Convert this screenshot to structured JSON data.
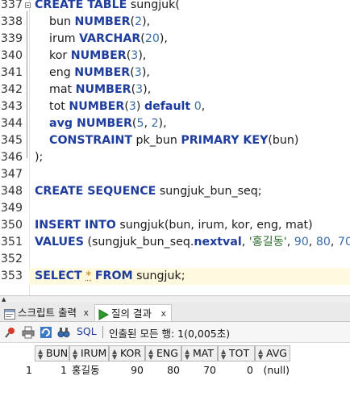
{
  "editor": {
    "lines": [
      {
        "num": "337",
        "code": [
          [
            "kw",
            "CREATE TABLE"
          ],
          [
            "t",
            " sungjuk("
          ]
        ]
      },
      {
        "num": "338",
        "code": [
          [
            "t",
            "    bun "
          ],
          [
            "kw",
            "NUMBER"
          ],
          [
            "t",
            "("
          ],
          [
            "num",
            "2"
          ],
          [
            "t",
            "),"
          ]
        ]
      },
      {
        "num": "339",
        "code": [
          [
            "t",
            "    irum "
          ],
          [
            "kw",
            "VARCHAR"
          ],
          [
            "t",
            "("
          ],
          [
            "num",
            "20"
          ],
          [
            "t",
            "),"
          ]
        ]
      },
      {
        "num": "340",
        "code": [
          [
            "t",
            "    kor "
          ],
          [
            "kw",
            "NUMBER"
          ],
          [
            "t",
            "("
          ],
          [
            "num",
            "3"
          ],
          [
            "t",
            "),"
          ]
        ]
      },
      {
        "num": "341",
        "code": [
          [
            "t",
            "    eng "
          ],
          [
            "kw",
            "NUMBER"
          ],
          [
            "t",
            "("
          ],
          [
            "num",
            "3"
          ],
          [
            "t",
            "),"
          ]
        ]
      },
      {
        "num": "342",
        "code": [
          [
            "t",
            "    mat "
          ],
          [
            "kw",
            "NUMBER"
          ],
          [
            "t",
            "("
          ],
          [
            "num",
            "3"
          ],
          [
            "t",
            "),"
          ]
        ]
      },
      {
        "num": "343",
        "code": [
          [
            "t",
            "    tot "
          ],
          [
            "kw",
            "NUMBER"
          ],
          [
            "t",
            "("
          ],
          [
            "num",
            "3"
          ],
          [
            "t",
            ") "
          ],
          [
            "kw",
            "default"
          ],
          [
            "t",
            " "
          ],
          [
            "num",
            "0"
          ],
          [
            "t",
            ","
          ]
        ]
      },
      {
        "num": "344",
        "code": [
          [
            "t",
            "    "
          ],
          [
            "kw",
            "avg NUMBER"
          ],
          [
            "t",
            "("
          ],
          [
            "num",
            "5"
          ],
          [
            "t",
            ", "
          ],
          [
            "num",
            "2"
          ],
          [
            "t",
            "),"
          ]
        ]
      },
      {
        "num": "345",
        "code": [
          [
            "t",
            "    "
          ],
          [
            "kw",
            "CONSTRAINT"
          ],
          [
            "t",
            " pk_bun "
          ],
          [
            "kw",
            "PRIMARY KEY"
          ],
          [
            "t",
            "(bun)"
          ]
        ]
      },
      {
        "num": "346",
        "code": [
          [
            "t",
            ");"
          ]
        ]
      },
      {
        "num": "347",
        "code": []
      },
      {
        "num": "348",
        "code": [
          [
            "kw",
            "CREATE SEQUENCE"
          ],
          [
            "t",
            " sungjuk_bun_seq;"
          ]
        ]
      },
      {
        "num": "349",
        "code": []
      },
      {
        "num": "350",
        "code": [
          [
            "kw",
            "INSERT INTO"
          ],
          [
            "t",
            " sungjuk(bun, irum, kor, eng, mat)"
          ]
        ]
      },
      {
        "num": "351",
        "code": [
          [
            "kw",
            "VALUES"
          ],
          [
            "t",
            " (sungjuk_bun_seq."
          ],
          [
            "kw",
            "nextval"
          ],
          [
            "t",
            ", "
          ],
          [
            "str",
            "'홍길동'"
          ],
          [
            "t",
            ", "
          ],
          [
            "num",
            "90"
          ],
          [
            "t",
            ", "
          ],
          [
            "num",
            "80"
          ],
          [
            "t",
            ", "
          ],
          [
            "num",
            "70"
          ],
          [
            "t",
            ");"
          ]
        ]
      },
      {
        "num": "352",
        "code": []
      },
      {
        "num": "353",
        "code": [
          [
            "kw",
            "SELECT"
          ],
          [
            "t",
            " "
          ],
          [
            "ast",
            "*"
          ],
          [
            "t",
            " "
          ],
          [
            "kw",
            "FROM"
          ],
          [
            "t",
            " sungjuk;"
          ]
        ]
      }
    ]
  },
  "tabs": [
    {
      "label": "스크립트 출력",
      "close": "x",
      "icon": "script-output-icon"
    },
    {
      "label": "질의 결과",
      "close": "x",
      "icon": "query-result-icon"
    }
  ],
  "toolbar": {
    "sql_label": "SQL",
    "status": "인출된 모든 행: 1(0,005초)",
    "icons": [
      "pin-icon",
      "print-icon",
      "refresh-icon",
      "binoculars-icon"
    ]
  },
  "grid": {
    "columns": [
      "BUN",
      "IRUM",
      "KOR",
      "ENG",
      "MAT",
      "TOT",
      "AVG"
    ],
    "rows": [
      {
        "rownum": "1",
        "cells": [
          "1",
          "홍길동",
          "90",
          "80",
          "70",
          "0",
          "(null)"
        ]
      }
    ]
  },
  "colors": {
    "keyword": "#1f3d9c",
    "number": "#3b6ea5",
    "string": "#2c6e2c",
    "current_line": "#fff9e0"
  }
}
